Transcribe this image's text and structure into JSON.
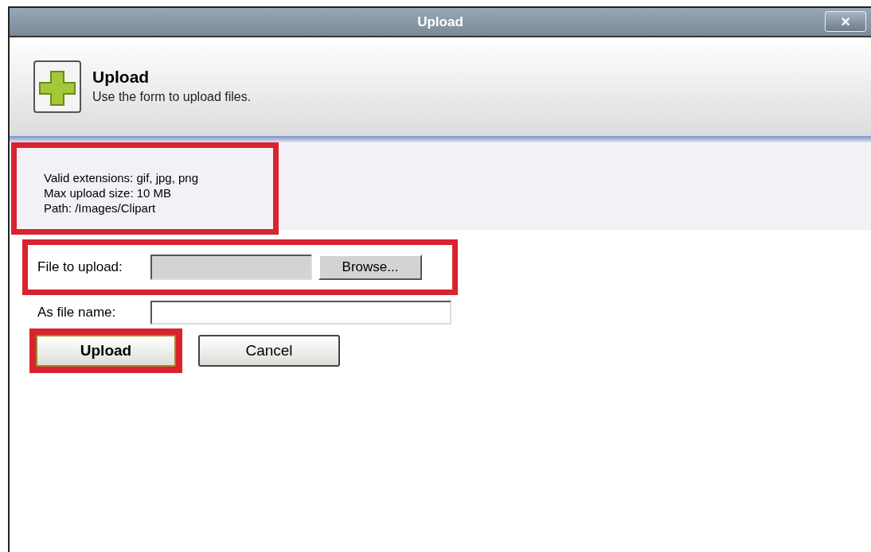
{
  "window": {
    "title": "Upload",
    "close_label": "×"
  },
  "header": {
    "title": "Upload",
    "subtitle": "Use the form to upload files."
  },
  "info": {
    "highlighted": true,
    "lines": [
      "Valid extensions: gif, jpg, png",
      "Max upload size: 10 MB",
      "Path: /Images/Clipart"
    ]
  },
  "fields": [
    {
      "kind": "file",
      "label": "File to upload:",
      "disabled": true,
      "button": "Browse...",
      "highlighted": true
    },
    {
      "kind": "text",
      "label": "As file name:",
      "disabled": false,
      "highlighted": false
    }
  ],
  "buttons": [
    {
      "label": "Upload",
      "primary": true,
      "highlighted": true
    },
    {
      "label": "Cancel",
      "primary": false,
      "highlighted": false
    }
  ]
}
